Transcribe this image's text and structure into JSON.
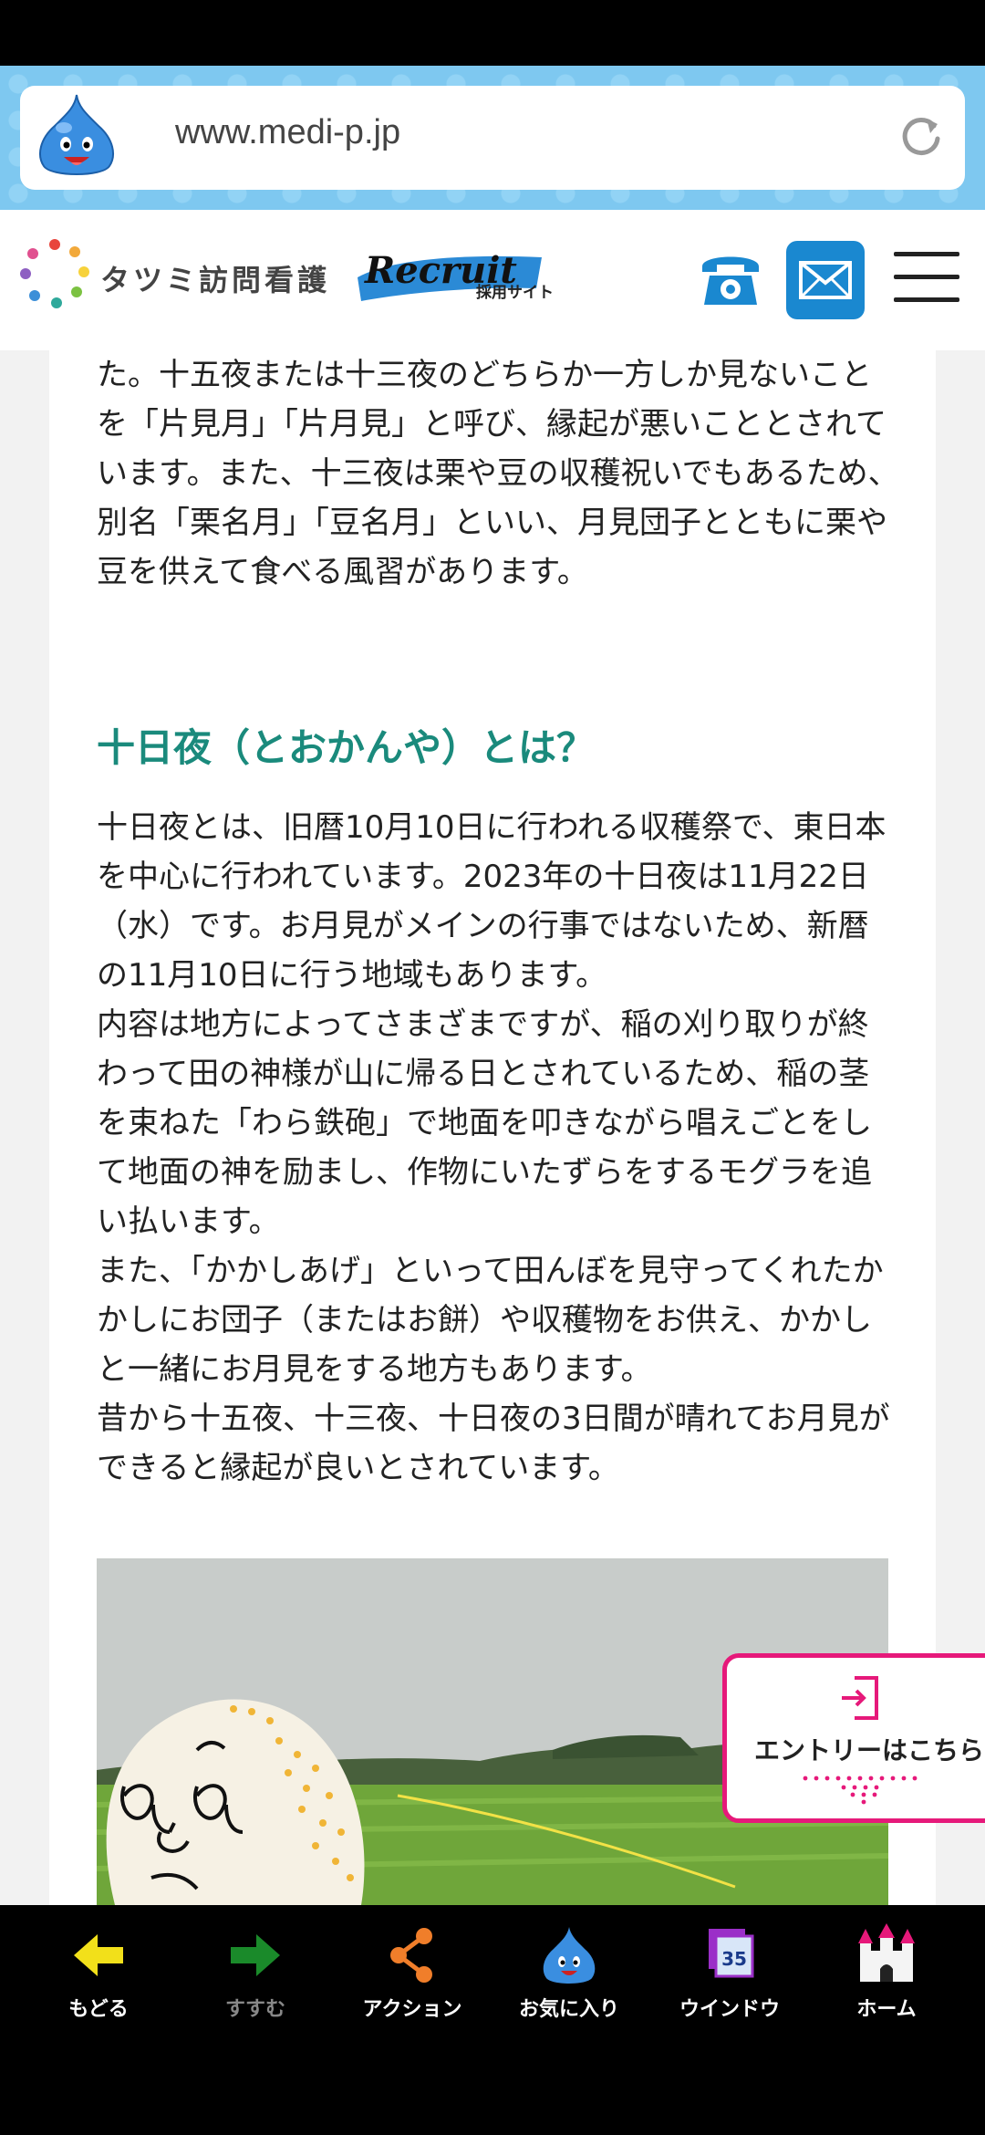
{
  "browser": {
    "url": "www.medi-p.jp"
  },
  "header": {
    "brand": "タツミ訪問看護",
    "recruit_logo": "Recruit",
    "recruit_sub": "採用サイト",
    "tel_icon": "phone-icon",
    "mail_icon": "mail-icon",
    "menu_icon": "hamburger-icon"
  },
  "article": {
    "para1": "た。十五夜または十三夜のどちらか一方しか見ないことを「片見月」「片月見」と呼び、縁起が悪いこととされています。また、十三夜は栗や豆の収穫祝いでもあるため、別名「栗名月」「豆名月」といい、月見団子とともに栗や豆を供えて食べる風習があります。",
    "heading": "十日夜（とおかんや）とは？",
    "para2": "十日夜とは、旧暦10月10日に行われる収穫祭で、東日本を中心に行われています。2023年の十日夜は11月22日（水）です。お月見がメインの行事ではないため、新暦の11月10日に行う地域もあります。\n内容は地方によってさまざまですが、稲の刈り取りが終わって田の神様が山に帰る日とされているため、稲の茎を束ねた「わら鉄砲」で地面を叩きながら唱えごとをして地面の神を励まし、作物にいたずらをするモグラを追い払います。\nまた、「かかしあげ」といって田んぼを見守ってくれたかかしにお団子（またはお餅）や収穫物をお供え、かかしと一緒にお月見をする地方もあります。\n昔から十五夜、十三夜、十日夜の3日間が晴れてお月見ができると縁起が良いとされています。"
  },
  "entry": {
    "label": "エントリーはこちら"
  },
  "bottom_nav": {
    "back": "もどる",
    "forward": "すすむ",
    "action": "アクション",
    "favorites": "お気に入り",
    "window": "ウインドウ",
    "window_count": "35",
    "home": "ホーム"
  },
  "colors": {
    "heading": "#1a8a7c",
    "accent_pink": "#e6197a",
    "mail_blue": "#1a88d0"
  }
}
